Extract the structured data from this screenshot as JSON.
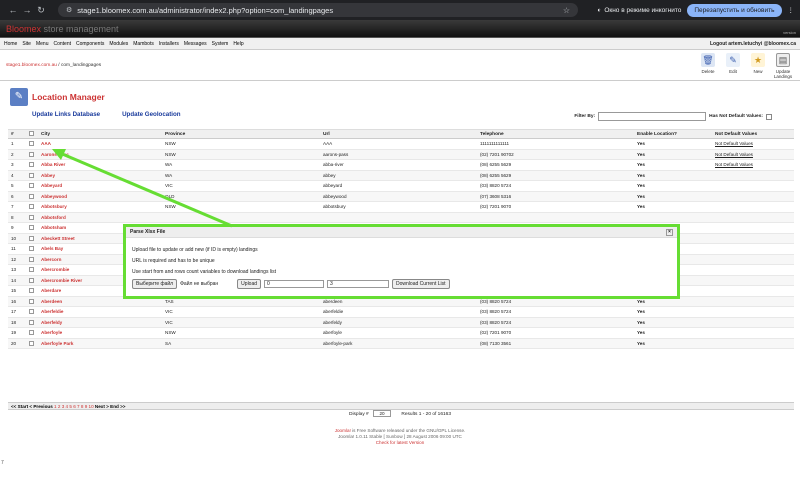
{
  "browser": {
    "url": "stage1.bloomex.com.au/administrator/index2.php?option=com_landingpages",
    "incognito_label": "Окно в режиме инкогнито",
    "relaunch_label": "Перезапустить и обновить"
  },
  "header": {
    "brand": "Bloomex",
    "brand_suffix": " store management",
    "version": "version"
  },
  "menu": {
    "items": [
      "Home",
      "Site",
      "Menu",
      "Content",
      "Components",
      "Modules",
      "Mambots",
      "Installers",
      "Messages",
      "System",
      "Help"
    ],
    "logout": "Logout artem.letuchyi @bloomex.ca"
  },
  "pathway": {
    "site": "stage1.bloomex.com.au",
    "sep": " / ",
    "current": "com_landingpages"
  },
  "toolbar": [
    "Delete",
    "Edit",
    "New",
    "Update Landings"
  ],
  "page": {
    "title": "Location Manager",
    "link_update_links": "Update Links Database",
    "link_update_geo": "Update Geolocation",
    "filter_label": "Filter By:",
    "has_not_default": "Has Not Default Values:"
  },
  "table": {
    "headers": [
      "#",
      "",
      "City",
      "Province",
      "Url",
      "Telephone",
      "Enable Location?",
      "Not Default Values"
    ],
    "rows": [
      [
        "1",
        "AAA",
        "NSW",
        "AAA",
        "1111111111111",
        "Yes",
        "Not Default Values"
      ],
      [
        "2",
        "Aarons Pass",
        "NSW",
        "aarons-pass",
        "(02) 7201 90702",
        "Yes",
        "Not Default Values"
      ],
      [
        "3",
        "Abba River",
        "WA",
        "abba-river",
        "(08) 6255 5629",
        "Yes",
        "Not Default Values"
      ],
      [
        "4",
        "Abbey",
        "WA",
        "abbey",
        "(08) 6255 5629",
        "Yes",
        ""
      ],
      [
        "5",
        "Abbeyard",
        "VIC",
        "abbeyard",
        "(03) 8820 5724",
        "Yes",
        ""
      ],
      [
        "6",
        "Abbeywood",
        "QLD",
        "abbeywood",
        "(07) 3608 5316",
        "Yes",
        ""
      ],
      [
        "7",
        "Abbotsbury",
        "NSW",
        "abbotsbury",
        "(02) 7201 9070",
        "Yes",
        ""
      ],
      [
        "8",
        "Abbotsford",
        "",
        "",
        "",
        "",
        ""
      ],
      [
        "9",
        "Abbotsham",
        "",
        "",
        "",
        "",
        ""
      ],
      [
        "10",
        "Abeckett Street",
        "",
        "",
        "",
        "",
        ""
      ],
      [
        "11",
        "Abels Bay",
        "",
        "",
        "",
        "",
        ""
      ],
      [
        "12",
        "Abercorn",
        "",
        "",
        "",
        "",
        ""
      ],
      [
        "13",
        "Abercrombie",
        "",
        "",
        "",
        "",
        ""
      ],
      [
        "14",
        "Abercrombie River",
        "NSW",
        "abercrombie-river",
        "(02) 7201 9070",
        "Yes",
        ""
      ],
      [
        "15",
        "Aberdare",
        "NSW",
        "aberdare",
        "(02) 7201 9070",
        "Yes",
        ""
      ],
      [
        "16",
        "Aberdeen",
        "TAS",
        "aberdeen",
        "(03) 8820 5724",
        "Yes",
        ""
      ],
      [
        "17",
        "Aberfeldie",
        "VIC",
        "aberfeldie",
        "(03) 8820 5724",
        "Yes",
        ""
      ],
      [
        "18",
        "Aberfeldy",
        "VIC",
        "aberfeldy",
        "(03) 8820 5724",
        "Yes",
        ""
      ],
      [
        "19",
        "Aberfoyle",
        "NSW",
        "aberfoyle",
        "(02) 7201 9070",
        "Yes",
        ""
      ],
      [
        "20",
        "Aberfoyle Park",
        "SA",
        "aberfoyle-park",
        "(08) 7130 3561",
        "Yes",
        ""
      ]
    ]
  },
  "pagination": {
    "start": "<< Start",
    "prev": "< Previous",
    "pages": "1 2 3 4 5 6 7 8 9 10",
    "next": "Next >",
    "end": "End >>"
  },
  "display": {
    "label": "Display #",
    "value": "20",
    "results": "Results 1 - 20 of 16163"
  },
  "footer": {
    "joomla": "Joomla!",
    "line1": " is Free Software released under the GNU/GPL License.",
    "line2": "Joomla! 1.0.11 Stable [ Sunbow ] 28 August 2006 09:00 UTC",
    "line3": "Check for latest Version"
  },
  "stray_char": "7",
  "modal": {
    "title": "Parse Xlsx File",
    "line1": "Upload file to update or add new (if ID is empty) landings",
    "line2": "URL is required and has to be unique",
    "line3": "Use start from and rows count variables to download landings list",
    "choose_file": "Выберите файл",
    "no_file": "Файл не выбран",
    "upload": "Upload",
    "start_value": "0",
    "count_value": "3",
    "download": "Download Current List"
  },
  "colors": {
    "accent": "#cc3333",
    "highlight": "#66dd33",
    "link": "#1a3b9c"
  }
}
